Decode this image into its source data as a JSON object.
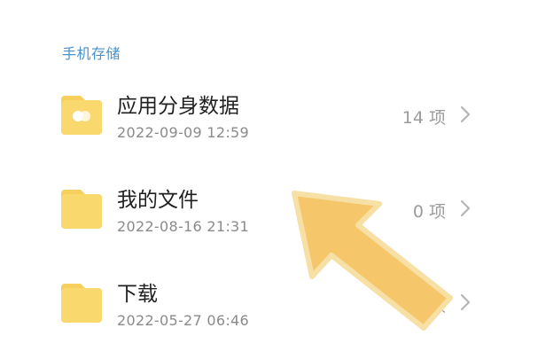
{
  "section": {
    "title": "手机存储"
  },
  "items": [
    {
      "name": "应用分身数据",
      "date": "2022-09-09 12:59",
      "count": "14 项",
      "icon": "app-clone-folder-icon"
    },
    {
      "name": "我的文件",
      "date": "2022-08-16 21:31",
      "count": "0 项",
      "icon": "folder-icon"
    },
    {
      "name": "下载",
      "date": "2022-05-27 06:46",
      "count": "0 项",
      "icon": "folder-icon"
    }
  ],
  "colors": {
    "accent": "#4a90c9",
    "folder": "#f9d86e",
    "folder_tab": "#f6cf5c",
    "arrow_overlay": "#f5c76a"
  },
  "overlay": {
    "icon": "pointing-arrow-icon"
  }
}
